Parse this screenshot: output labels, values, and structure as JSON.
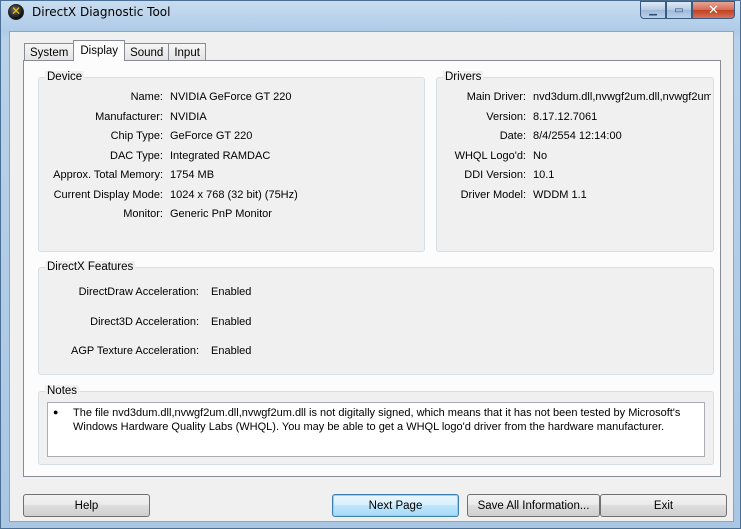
{
  "window": {
    "title": "DirectX Diagnostic Tool"
  },
  "tabs": [
    {
      "label": "System"
    },
    {
      "label": "Display"
    },
    {
      "label": "Sound"
    },
    {
      "label": "Input"
    }
  ],
  "active_tab": "Display",
  "device": {
    "title": "Device",
    "rows": [
      {
        "label": "Name:",
        "value": "NVIDIA GeForce GT 220"
      },
      {
        "label": "Manufacturer:",
        "value": "NVIDIA"
      },
      {
        "label": "Chip Type:",
        "value": "GeForce GT 220"
      },
      {
        "label": "DAC Type:",
        "value": "Integrated RAMDAC"
      },
      {
        "label": "Approx. Total Memory:",
        "value": "1754 MB"
      },
      {
        "label": "Current Display Mode:",
        "value": "1024 x 768 (32 bit) (75Hz)"
      },
      {
        "label": "Monitor:",
        "value": "Generic PnP Monitor"
      }
    ]
  },
  "drivers": {
    "title": "Drivers",
    "rows": [
      {
        "label": "Main Driver:",
        "value": "nvd3dum.dll,nvwgf2um.dll,nvwgf2um"
      },
      {
        "label": "Version:",
        "value": "8.17.12.7061"
      },
      {
        "label": "Date:",
        "value": "8/4/2554 12:14:00"
      },
      {
        "label": "WHQL Logo'd:",
        "value": "No"
      },
      {
        "label": "DDI Version:",
        "value": "10.1"
      },
      {
        "label": "Driver Model:",
        "value": "WDDM 1.1"
      }
    ]
  },
  "features": {
    "title": "DirectX Features",
    "rows": [
      {
        "label": "DirectDraw Acceleration:",
        "value": "Enabled"
      },
      {
        "label": "Direct3D Acceleration:",
        "value": "Enabled"
      },
      {
        "label": "AGP Texture Acceleration:",
        "value": "Enabled"
      }
    ]
  },
  "notes": {
    "title": "Notes",
    "text": "The file nvd3dum.dll,nvwgf2um.dll,nvwgf2um.dll is not digitally signed, which means that it has not been tested by Microsoft's Windows Hardware Quality Labs (WHQL).  You may be able to get a WHQL logo'd driver from the hardware manufacturer."
  },
  "buttons": {
    "help": "Help",
    "next_page": "Next Page",
    "save_all": "Save All Information...",
    "exit": "Exit"
  }
}
